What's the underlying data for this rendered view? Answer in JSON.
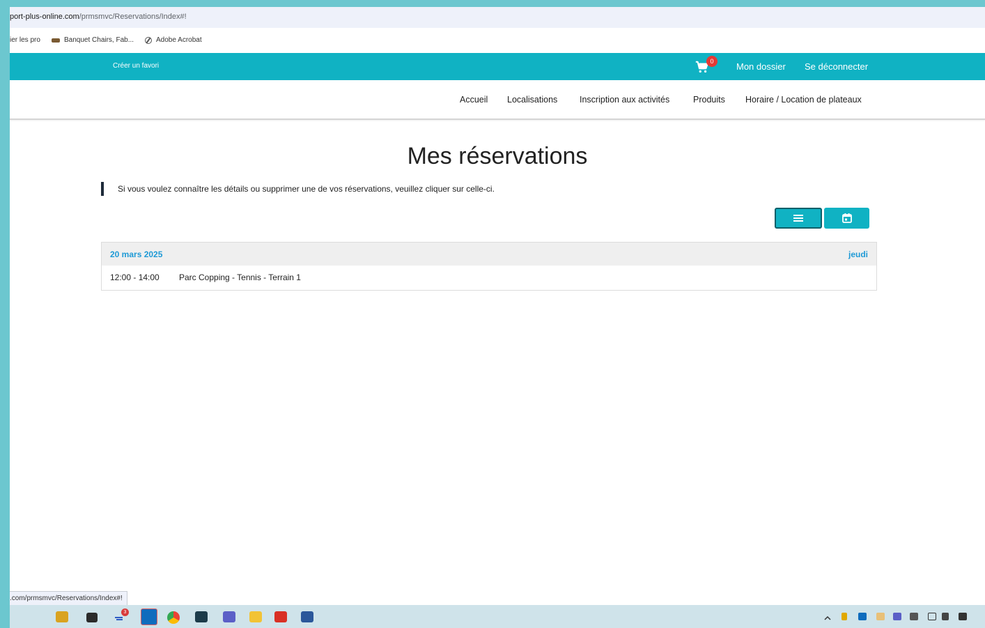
{
  "browser": {
    "url_host": "port-plus-online.com",
    "url_path": "/prmsmvc/Reservations/Index#!",
    "bookmarks": [
      {
        "label": "ier les pro",
        "icon": "none"
      },
      {
        "label": "Banquet Chairs, Fab...",
        "icon": "banquet-logo-icon"
      },
      {
        "label": "Adobe Acrobat",
        "icon": "globe-icon"
      }
    ],
    "status_url": ".com/prmsmvc/Reservations/Index#!"
  },
  "header": {
    "favorite_label": "Créer un favori",
    "cart_count": "0",
    "my_file_label": "Mon dossier",
    "logout_label": "Se déconnecter"
  },
  "nav": {
    "items": [
      {
        "label": "Accueil"
      },
      {
        "label": "Localisations"
      },
      {
        "label": "Inscription aux activités"
      },
      {
        "label": "Produits"
      },
      {
        "label": "Horaire / Location de plateaux"
      }
    ]
  },
  "page": {
    "title": "Mes réservations",
    "info": "Si vous voulez connaître les détails ou supprimer une de vos réservations, veuillez cliquer sur celle-ci.",
    "view_buttons": [
      {
        "icon": "list-icon",
        "active": true
      },
      {
        "icon": "calendar-icon",
        "active": false
      }
    ]
  },
  "reservations": {
    "groups": [
      {
        "date": "20 mars 2025",
        "day": "jeudi",
        "items": [
          {
            "time": "12:00 - 14:00",
            "place": "Parc Copping - Tennis - Terrain 1"
          }
        ]
      }
    ]
  },
  "taskbar": {
    "teams_badge": "3"
  },
  "colors": {
    "brand_teal": "#10b2c3",
    "link_blue": "#1f9ad6",
    "badge_red": "#e53935"
  }
}
